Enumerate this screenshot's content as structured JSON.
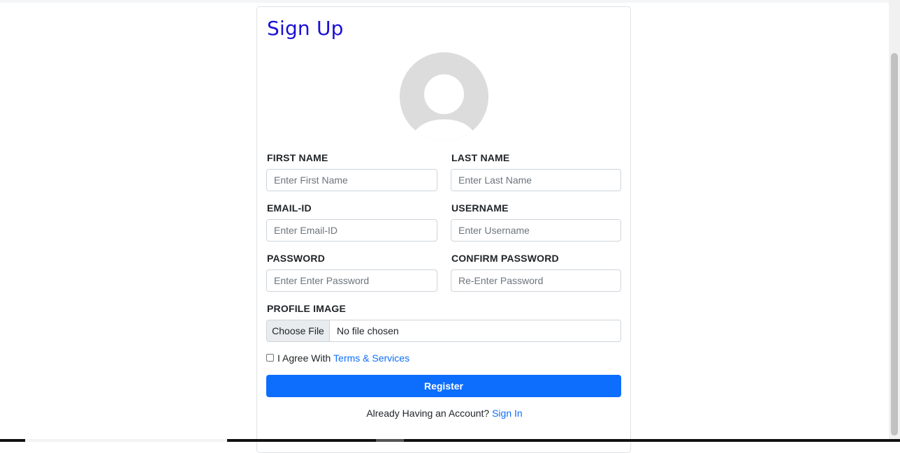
{
  "form": {
    "title": "Sign Up",
    "avatar_icon": "user-avatar-placeholder-icon",
    "fields": {
      "first_name": {
        "label": "FIRST NAME",
        "placeholder": "Enter First Name",
        "value": ""
      },
      "last_name": {
        "label": "LAST NAME",
        "placeholder": "Enter Last Name",
        "value": ""
      },
      "email": {
        "label": "EMAIL-ID",
        "placeholder": "Enter Email-ID",
        "value": ""
      },
      "username": {
        "label": "USERNAME",
        "placeholder": "Enter Username",
        "value": ""
      },
      "password": {
        "label": "PASSWORD",
        "placeholder": "Enter Enter Password",
        "value": ""
      },
      "confirm_password": {
        "label": "CONFIRM PASSWORD",
        "placeholder": "Re-Enter Password",
        "value": ""
      }
    },
    "profile_image": {
      "label": "PROFILE IMAGE",
      "button_label": "Choose File",
      "status": "No file chosen"
    },
    "agree": {
      "text": "I Agree With",
      "link": "Terms & Services",
      "checked": false
    },
    "register_label": "Register",
    "signin": {
      "text": "Already Having an Account?",
      "link": "Sign In"
    }
  },
  "colors": {
    "title": "#1a10d6",
    "primary": "#0d6efd",
    "avatar_bg": "#dcdcdc"
  }
}
